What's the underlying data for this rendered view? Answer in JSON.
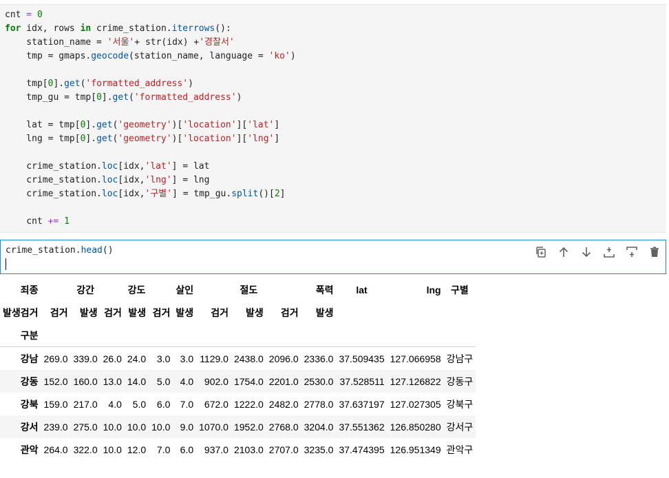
{
  "cell1": {
    "lines": {
      "l1": [
        "cnt",
        " = ",
        "0"
      ],
      "l2": [
        "for",
        " idx, rows ",
        "in",
        " crime_station.",
        "iterrows",
        "():"
      ],
      "l3": [
        "    station_name = ",
        "'서울'",
        "+ str(idx) +",
        "'경찰서'"
      ],
      "l4": [
        "    tmp = gmaps.",
        "geocode",
        "(station_name, language = ",
        "'ko'",
        ")"
      ],
      "l5": [
        "    tmp[",
        "0",
        "].",
        "get",
        "(",
        "'formatted_address'",
        ")"
      ],
      "l6": [
        "    tmp_gu = tmp[",
        "0",
        "].",
        "get",
        "(",
        "'formatted_address'",
        ")"
      ],
      "l7": [
        "    lat = tmp[",
        "0",
        "].",
        "get",
        "(",
        "'geometry'",
        ")[",
        "'location'",
        "][",
        "'lat'",
        "]"
      ],
      "l8": [
        "    lng = tmp[",
        "0",
        "].",
        "get",
        "(",
        "'geometry'",
        ")[",
        "'location'",
        "][",
        "'lng'",
        "]"
      ],
      "l9": [
        "    crime_station.",
        "loc",
        "[idx,",
        "'lat'",
        "] = lat"
      ],
      "l10": [
        "    crime_station.",
        "loc",
        "[idx,",
        "'lng'",
        "] = lng"
      ],
      "l11": [
        "    crime_station.",
        "loc",
        "[idx,",
        "'구별'",
        "] = tmp_gu.",
        "split",
        "()[",
        "2",
        "]"
      ],
      "l12": [
        "    cnt ",
        "+=",
        " ",
        "1"
      ]
    }
  },
  "cell2": {
    "code_obj": "crime_station.",
    "code_fn": "head",
    "code_end": "()"
  },
  "toolbar": {
    "icons": [
      "copy-icon",
      "move-up-icon",
      "move-down-icon",
      "insert-above-icon",
      "insert-below-icon",
      "delete-icon"
    ]
  },
  "dataframe": {
    "header_row1": [
      "죄종",
      "강간",
      "강도",
      "살인",
      "절도",
      "폭력",
      "lat",
      "lng",
      "구별"
    ],
    "header_row2": [
      "발생검거",
      "검거",
      "발생",
      "검거",
      "발생",
      "검거",
      "발생",
      "검거",
      "발생",
      "검거",
      "발생"
    ],
    "index_name": "구분",
    "rows": [
      {
        "index": "강남",
        "cells": [
          "269.0",
          "339.0",
          "26.0",
          "24.0",
          "3.0",
          "3.0",
          "1129.0",
          "2438.0",
          "2096.0",
          "2336.0",
          "37.509435",
          "127.066958",
          "강남구"
        ]
      },
      {
        "index": "강동",
        "cells": [
          "152.0",
          "160.0",
          "13.0",
          "14.0",
          "5.0",
          "4.0",
          "902.0",
          "1754.0",
          "2201.0",
          "2530.0",
          "37.528511",
          "127.126822",
          "강동구"
        ]
      },
      {
        "index": "강북",
        "cells": [
          "159.0",
          "217.0",
          "4.0",
          "5.0",
          "6.0",
          "7.0",
          "672.0",
          "1222.0",
          "2482.0",
          "2778.0",
          "37.637197",
          "127.027305",
          "강북구"
        ]
      },
      {
        "index": "강서",
        "cells": [
          "239.0",
          "275.0",
          "10.0",
          "10.0",
          "10.0",
          "9.0",
          "1070.0",
          "1952.0",
          "2768.0",
          "3204.0",
          "37.551362",
          "126.850280",
          "강서구"
        ]
      },
      {
        "index": "관악",
        "cells": [
          "264.0",
          "322.0",
          "10.0",
          "12.0",
          "7.0",
          "6.0",
          "937.0",
          "2103.0",
          "2707.0",
          "3235.0",
          "37.474395",
          "126.951349",
          "관악구"
        ]
      }
    ]
  }
}
